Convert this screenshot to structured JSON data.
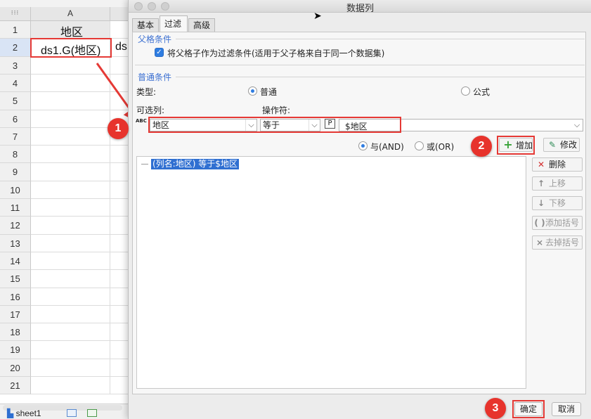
{
  "spreadsheet": {
    "corner_label": "⁝⁝⁝",
    "column_label": "A",
    "rows": [
      "1",
      "2",
      "3",
      "4",
      "5",
      "6",
      "7",
      "8",
      "9",
      "10",
      "11",
      "12",
      "13",
      "14",
      "15",
      "16",
      "17",
      "18",
      "19",
      "20",
      "21"
    ],
    "cell_a1": "地区",
    "cell_a2": "ds1.G(地区)",
    "cell_b2_partial": "ds",
    "sheet_tab": "sheet1"
  },
  "dialog": {
    "title": "数据列",
    "tabs": [
      {
        "label": "基本",
        "active": false
      },
      {
        "label": "过滤",
        "active": true
      },
      {
        "label": "高级",
        "active": false
      }
    ],
    "parent_section": {
      "title": "父格条件",
      "checkbox_label": "将父格子作为过滤条件(适用于父子格来自于同一个数据集)",
      "checked": true
    },
    "normal_section": {
      "title": "普通条件",
      "type_label": "类型:",
      "type_normal": "普通",
      "type_formula": "公式",
      "type_selected": "普通",
      "columns_label": "可选列:",
      "operator_label": "操作符:",
      "column_value": "地区",
      "operator_value": "等于",
      "param_icon": "P",
      "value": "$地区",
      "abc_icon": "ABC"
    },
    "logic": {
      "and_label": "与(AND)",
      "or_label": "或(OR)",
      "selected": "and"
    },
    "buttons": {
      "add": "增加",
      "modify": "修改",
      "delete": "删除",
      "move_up": "上移",
      "move_down": "下移",
      "add_bracket": "添加括号",
      "remove_bracket": "去掉括号",
      "ok": "确定",
      "cancel": "取消"
    },
    "conditions": [
      "(列名:地区) 等于$地区"
    ]
  },
  "annotations": [
    "1",
    "2",
    "3"
  ],
  "colors": {
    "accent": "#2f7de1",
    "section_title": "#3b6fd1",
    "annotation_red": "#e53935",
    "selection": "#2f6fd1"
  }
}
